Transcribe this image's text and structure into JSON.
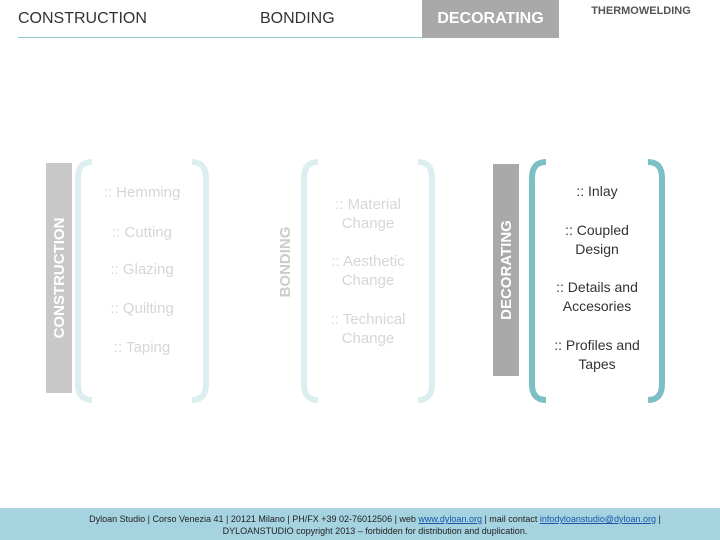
{
  "tabs": {
    "construction": "CONSTRUCTION",
    "bonding": "BONDING",
    "decorating": "DECORATING",
    "thermowelding": "THERMOWELDING"
  },
  "columns": {
    "construction": {
      "label": "CONSTRUCTION",
      "items": [
        ":: Hemming",
        ":: Cutting",
        ":: Glazing",
        ":: Quilting",
        ":: Taping"
      ]
    },
    "bonding": {
      "label": "BONDING",
      "items": [
        ":: Material Change",
        ":: Aesthetic Change",
        ":: Technical Change"
      ]
    },
    "decorating": {
      "label": "DECORATING",
      "items": [
        ":: Inlay",
        ":: Coupled Design",
        ":: Details and Accesories",
        ":: Profiles and Tapes"
      ]
    }
  },
  "footer": {
    "line1_prefix": "Dyloan Studio | Corso Venezia 41 | 20121 Milano | PH/FX +39 02-76012506 | web ",
    "web_link": "www.dyloan.org",
    "line1_mid": " | mail contact ",
    "mail_link": "infodyloanstudio@dyloan.org",
    "line1_suffix": " |",
    "line2": "DYLOANSTUDIO copyright 2013 – forbidden for distribution and duplication."
  },
  "colors": {
    "accent_teal": "#7cc0c6",
    "faded_teal": "#dceef0",
    "tab_gray": "#a9a9a9",
    "footer_blue": "#a6d3e0"
  }
}
